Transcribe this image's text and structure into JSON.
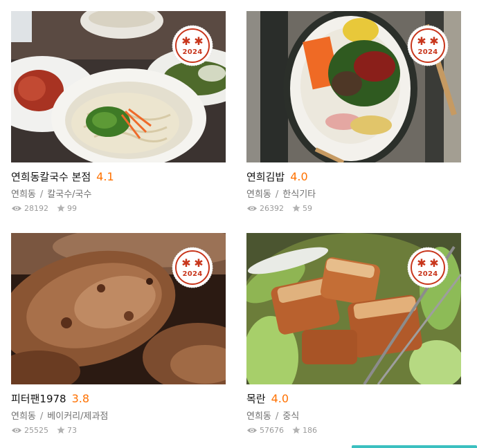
{
  "restaurants": [
    {
      "name": "연희동칼국수 본점",
      "score": "4.1",
      "area": "연희동",
      "category": "칼국수/국수",
      "views": "28192",
      "reviews": "99",
      "badge_year": "2024",
      "badge_icon": "twin-asterisk-icon"
    },
    {
      "name": "연희김밥",
      "score": "4.0",
      "area": "연희동",
      "category": "한식기타",
      "views": "26392",
      "reviews": "59",
      "badge_year": "2024",
      "badge_icon": "twin-asterisk-icon"
    },
    {
      "name": "피터팬1978",
      "score": "3.8",
      "area": "연희동",
      "category": "베이커리/제과점",
      "views": "25525",
      "reviews": "73",
      "badge_year": "2024",
      "badge_icon": "twin-asterisk-icon"
    },
    {
      "name": "목란",
      "score": "4.0",
      "area": "연희동",
      "category": "중식",
      "views": "57676",
      "reviews": "186",
      "badge_year": "2024",
      "badge_icon": "twin-asterisk-icon"
    }
  ],
  "separator": "/",
  "colors": {
    "score": "#ff7100",
    "badge_red": "#c8361c",
    "meta_text": "#6f6f6f",
    "stat_text": "#9a9a9a",
    "bottom_bar": "#3cc0c0"
  }
}
